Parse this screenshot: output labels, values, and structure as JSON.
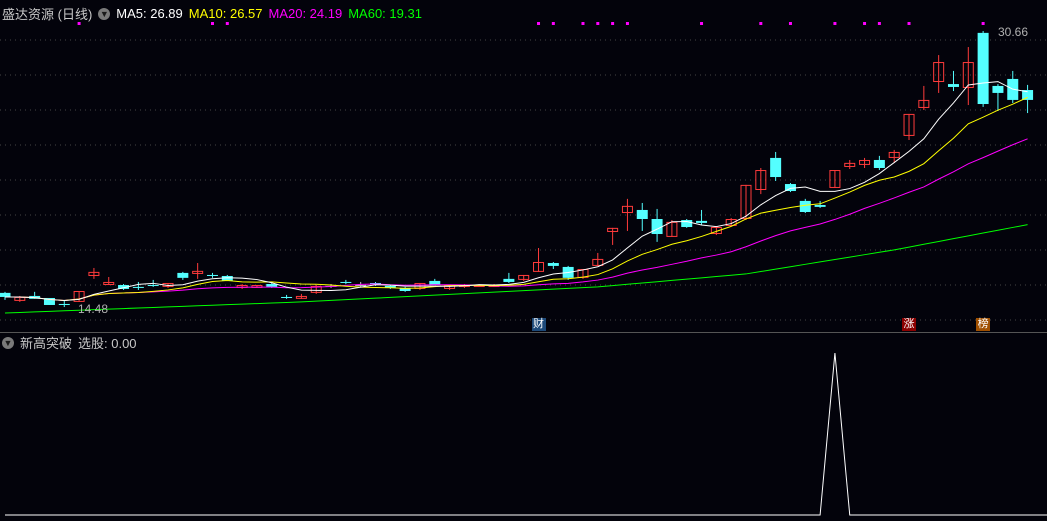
{
  "header": {
    "stock_name": "盛达资源 (日线)",
    "ma5": "MA5: 26.89",
    "ma10": "MA10: 26.57",
    "ma20": "MA20: 24.19",
    "ma60": "MA60: 19.31"
  },
  "indicator": {
    "name": "新高突破",
    "value_label": "选股: 0.00"
  },
  "labels": {
    "high": "30.66",
    "low": "14.48"
  },
  "badges": [
    {
      "text": "财",
      "index": 36,
      "color": "#1d4a7a"
    },
    {
      "text": "涨",
      "index": 61,
      "color": "#8b0000"
    },
    {
      "text": "榜",
      "index": 66,
      "color": "#a05000"
    }
  ],
  "colors": {
    "up": "#ff3b3b",
    "down": "#54ffff",
    "flat": "#c0c0c0",
    "ma5": "#ffffff",
    "ma10": "#ffff00",
    "ma20": "#ff00ff",
    "ma60": "#00ff00",
    "signal": "#ff00ff"
  },
  "chart_data": {
    "type": "candlestick",
    "price_range": [
      13.9,
      31.2
    ],
    "candles": [
      [
        15.31,
        15.07,
        15.37,
        14.9
      ],
      [
        14.84,
        15.07,
        15.13,
        14.78
      ],
      [
        15.13,
        14.96,
        15.37,
        14.96
      ],
      [
        15.01,
        14.6,
        15.01,
        14.6
      ],
      [
        14.66,
        14.6,
        14.9,
        14.48
      ],
      [
        14.78,
        15.42,
        15.42,
        14.78
      ],
      [
        16.3,
        16.54,
        16.77,
        16.13
      ],
      [
        15.77,
        15.95,
        16.24,
        15.77
      ],
      [
        15.77,
        15.54,
        15.83,
        15.48
      ],
      [
        15.66,
        15.6,
        15.95,
        15.48
      ],
      [
        15.77,
        15.72,
        16.07,
        15.66
      ],
      [
        15.66,
        15.89,
        15.89,
        15.6
      ],
      [
        16.48,
        16.19,
        16.54,
        16.07
      ],
      [
        16.42,
        16.6,
        17.06,
        16.13
      ],
      [
        16.36,
        16.3,
        16.48,
        16.19
      ],
      [
        16.3,
        16.01,
        16.36,
        16.01
      ],
      [
        15.6,
        15.77,
        15.83,
        15.54
      ],
      [
        15.6,
        15.77,
        15.77,
        15.6
      ],
      [
        15.83,
        15.66,
        15.89,
        15.6
      ],
      [
        15.07,
        15.01,
        15.19,
        14.96
      ],
      [
        14.96,
        15.13,
        15.25,
        14.96
      ],
      [
        15.31,
        15.72,
        15.77,
        15.25
      ],
      [
        15.72,
        15.72,
        15.83,
        15.6
      ],
      [
        15.95,
        15.89,
        16.07,
        15.83
      ],
      [
        15.77,
        15.77,
        15.95,
        15.66
      ],
      [
        15.89,
        15.83,
        15.95,
        15.72
      ],
      [
        15.72,
        15.6,
        15.77,
        15.54
      ],
      [
        15.6,
        15.42,
        15.66,
        15.37
      ],
      [
        15.54,
        15.89,
        15.89,
        15.48
      ],
      [
        16.01,
        15.77,
        16.13,
        15.77
      ],
      [
        15.54,
        15.77,
        15.77,
        15.48
      ],
      [
        15.66,
        15.77,
        15.83,
        15.6
      ],
      [
        15.66,
        15.77,
        15.77,
        15.66
      ],
      [
        15.72,
        15.77,
        15.83,
        15.72
      ],
      [
        16.13,
        15.95,
        16.48,
        15.89
      ],
      [
        16.07,
        16.36,
        16.36,
        16.01
      ],
      [
        16.54,
        17.12,
        17.94,
        16.54
      ],
      [
        17.06,
        16.89,
        17.12,
        16.71
      ],
      [
        16.83,
        16.19,
        16.89,
        16.07
      ],
      [
        16.19,
        16.71,
        16.71,
        16.13
      ],
      [
        16.89,
        17.3,
        17.65,
        16.89
      ],
      [
        18.88,
        19.12,
        19.12,
        18.12
      ],
      [
        19.99,
        20.41,
        20.82,
        18.94
      ],
      [
        20.17,
        19.64,
        20.58,
        18.94
      ],
      [
        19.64,
        18.76,
        20.23,
        18.3
      ],
      [
        18.59,
        19.47,
        19.58,
        18.59
      ],
      [
        19.58,
        19.17,
        19.64,
        19.12
      ],
      [
        19.53,
        19.41,
        20.17,
        19.29
      ],
      [
        18.76,
        19.17,
        19.23,
        18.7
      ],
      [
        19.23,
        19.64,
        19.7,
        19.23
      ],
      [
        19.64,
        21.64,
        21.64,
        19.58
      ],
      [
        21.34,
        22.51,
        22.63,
        21.1
      ],
      [
        23.22,
        22.1,
        23.57,
        21.87
      ],
      [
        21.69,
        21.28,
        21.75,
        21.22
      ],
      [
        20.7,
        20.05,
        20.82,
        19.99
      ],
      [
        20.46,
        20.35,
        20.7,
        20.29
      ],
      [
        21.46,
        22.51,
        22.51,
        21.46
      ],
      [
        22.69,
        22.93,
        23.1,
        22.57
      ],
      [
        22.81,
        23.1,
        23.22,
        22.63
      ],
      [
        23.1,
        22.63,
        23.34,
        22.51
      ],
      [
        23.22,
        23.57,
        23.69,
        22.93
      ],
      [
        24.51,
        25.8,
        25.8,
        24.27
      ],
      [
        26.15,
        26.62,
        27.44,
        26.03
      ],
      [
        27.67,
        28.84,
        29.25,
        27.03
      ],
      [
        27.55,
        27.38,
        28.32,
        27.14
      ],
      [
        27.32,
        28.84,
        29.72,
        26.32
      ],
      [
        30.55,
        26.38,
        30.66,
        26.21
      ],
      [
        27.44,
        27.03,
        27.55,
        25.97
      ],
      [
        27.85,
        26.62,
        28.32,
        26.44
      ],
      [
        27.2,
        26.62,
        27.5,
        25.85
      ]
    ],
    "ma60_points": [
      [
        0,
        14.13
      ],
      [
        20,
        14.78
      ],
      [
        40,
        15.66
      ],
      [
        50,
        16.42
      ],
      [
        60,
        17.83
      ],
      [
        69,
        19.31
      ]
    ],
    "signal_days": [
      5,
      14,
      15,
      36,
      37,
      39,
      40,
      41,
      42,
      47,
      51,
      53,
      56,
      58,
      59,
      61,
      66
    ],
    "indicator_values_nonzero": [
      [
        56,
        1
      ]
    ],
    "indicator_range": [
      0,
      1
    ]
  }
}
